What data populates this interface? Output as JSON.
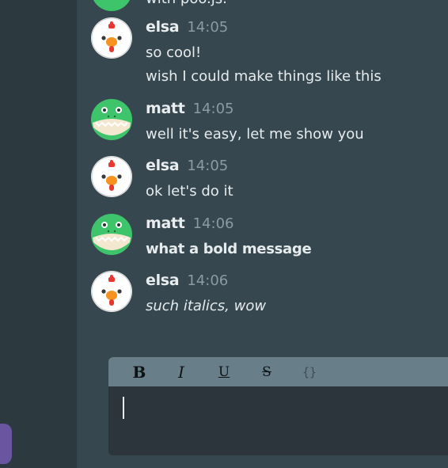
{
  "colors": {
    "sidebar": "#2c393f",
    "main": "#36474f",
    "accent_pill": "#6a55a0",
    "toolbar": "#687f8a",
    "editor": "#2c353b",
    "name_text": "#e9edef",
    "time_text": "#8b9ba3"
  },
  "partial_message": {
    "text": "with poo.js."
  },
  "messages": [
    {
      "user": "elsa",
      "avatar": "chicken-avatar-icon",
      "time": "14:05",
      "lines": [
        "so cool!",
        "wish I could make things like this"
      ],
      "style": "normal"
    },
    {
      "user": "matt",
      "avatar": "crocodile-avatar-icon",
      "time": "14:05",
      "lines": [
        "well it's easy, let me show you"
      ],
      "style": "normal"
    },
    {
      "user": "elsa",
      "avatar": "chicken-avatar-icon",
      "time": "14:05",
      "lines": [
        "ok let's do it"
      ],
      "style": "normal"
    },
    {
      "user": "matt",
      "avatar": "crocodile-avatar-icon",
      "time": "14:06",
      "lines": [
        "what a bold message"
      ],
      "style": "bold"
    },
    {
      "user": "elsa",
      "avatar": "chicken-avatar-icon",
      "time": "14:06",
      "lines": [
        "such italics, wow"
      ],
      "style": "italic"
    }
  ],
  "composer": {
    "toolbar": {
      "bold": "B",
      "italic": "I",
      "underline": "U",
      "strikethrough": "S",
      "code": "{}"
    },
    "value": ""
  }
}
